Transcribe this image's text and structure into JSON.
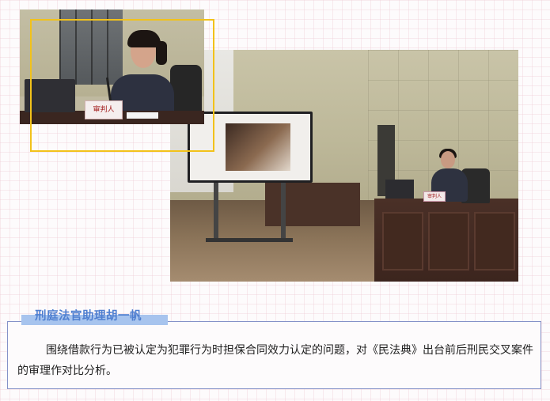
{
  "photos": {
    "main": {
      "nameplate": "审判人"
    },
    "inset": {
      "nameplate": "审判人"
    }
  },
  "caption": {
    "title": "刑庭法官助理胡一帆",
    "text": "围绕借款行为已被认定为犯罪行为时担保合同效力认定的问题，对《民法典》出台前后刑民交叉案件的审理作对比分析。"
  },
  "colors": {
    "frame": "#f2c21a",
    "title_text": "#4f7fd0",
    "title_bar": "#a7c4ee",
    "box_border": "#8592c8"
  }
}
